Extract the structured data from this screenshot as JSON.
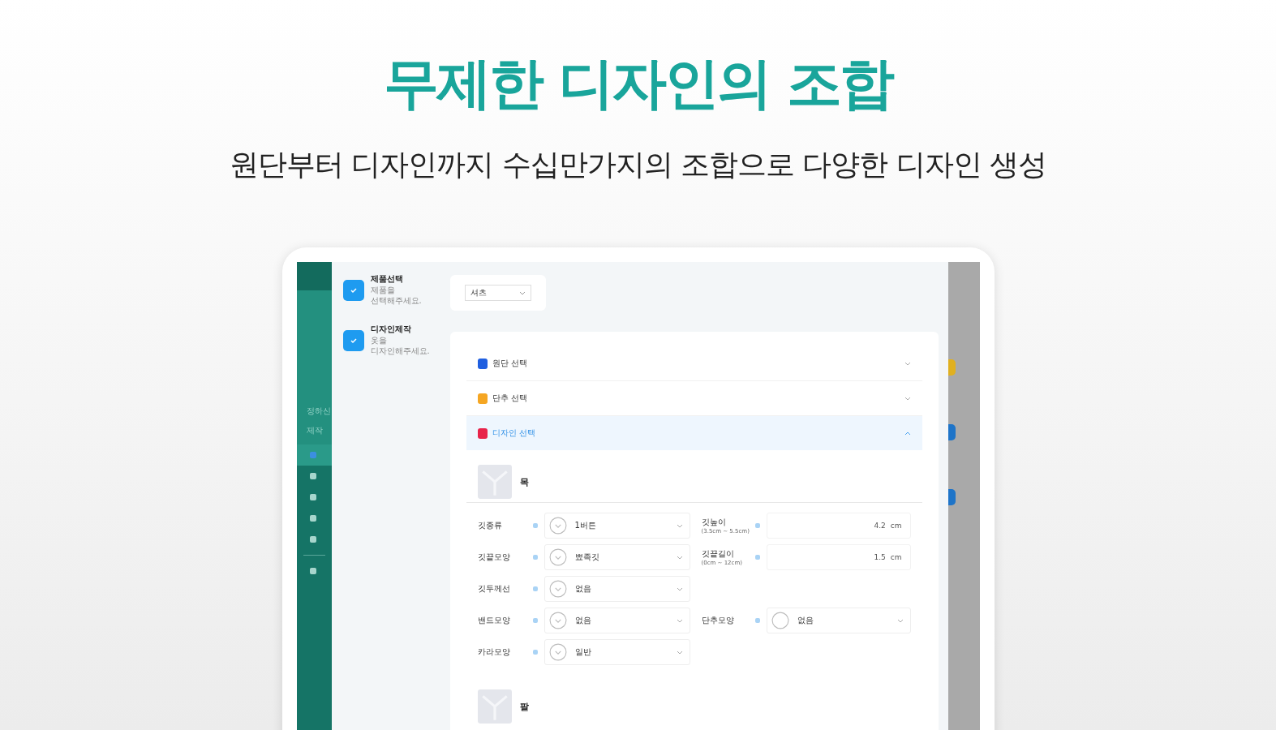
{
  "headline": "무제한 디자인의 조합",
  "subheadline": "원단부터 디자인까지 수십만가지의 조합으로 다양한 디자인 생성",
  "app": {
    "sidebar": {
      "labels": [
        "정하신",
        "제작"
      ],
      "items": [
        {
          "selected": true
        },
        {
          "selected": false
        },
        {
          "selected": false
        },
        {
          "selected": false
        },
        {
          "selected": false
        },
        {
          "selected": false
        }
      ]
    },
    "steps": [
      {
        "title": "제품선택",
        "subtitle": "제품을",
        "note": "선택해주세요.",
        "checked": true
      },
      {
        "title": "디자인제작",
        "subtitle": "옷을",
        "note": "디자인해주세요.",
        "checked": true
      }
    ],
    "product_select": {
      "value": "셔츠"
    },
    "accordion": [
      {
        "label": "원단 선택",
        "color": "#1f5fe0",
        "expanded": false
      },
      {
        "label": "단추 선택",
        "color": "#f5a623",
        "expanded": false
      },
      {
        "label": "디자인 선택",
        "color": "#e8234a",
        "expanded": true
      }
    ],
    "sections": [
      {
        "title": "목",
        "rows": [
          {
            "left": {
              "label": "깃종류",
              "value": "1버튼"
            },
            "right": {
              "kind": "number",
              "label": "깃높이",
              "range": "(3.5cm ~ 5.5cm)",
              "value": "4.2",
              "unit": "cm"
            }
          },
          {
            "left": {
              "label": "깃끝모양",
              "value": "뾰족깃"
            },
            "right": {
              "kind": "number",
              "label": "깃끝길이",
              "range": "(0cm ~ 12cm)",
              "value": "1.5",
              "unit": "cm"
            }
          },
          {
            "left": {
              "label": "깃두께선",
              "value": "없음"
            },
            "right": null
          },
          {
            "left": {
              "label": "밴드모양",
              "value": "없음"
            },
            "right": {
              "kind": "select",
              "label": "단추모양",
              "value": "없음"
            }
          },
          {
            "left": {
              "label": "카라모양",
              "value": "일반"
            },
            "right": null
          }
        ]
      },
      {
        "title": "팔"
      }
    ]
  }
}
